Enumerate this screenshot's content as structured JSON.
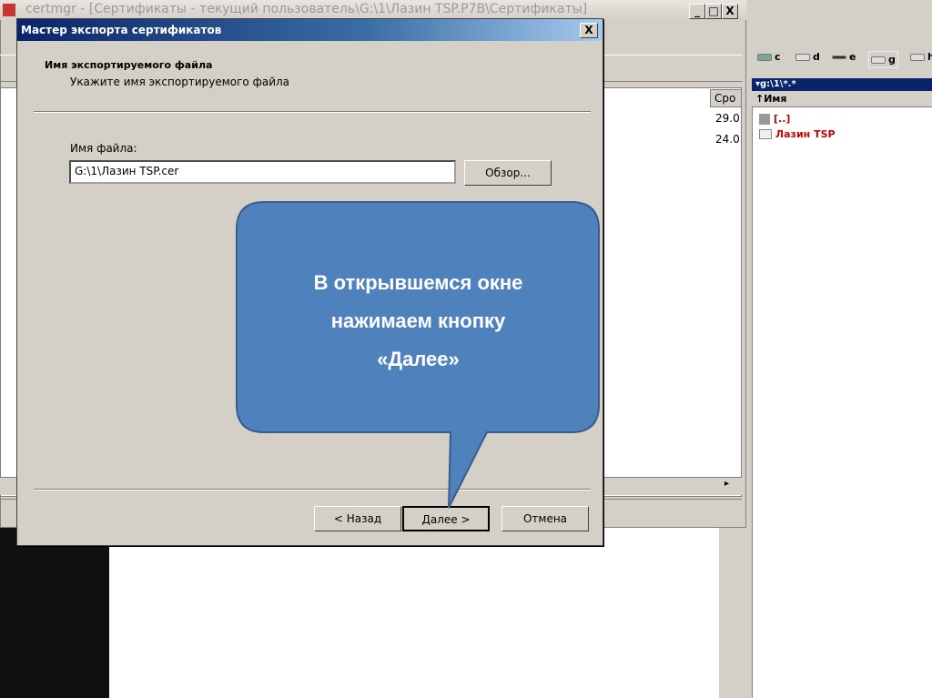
{
  "background_window": {
    "title": "certmgr - [Сертификаты - текущий пользователь\\G:\\1\\Лазин TSP.P7B\\Сертификаты]",
    "column_header": "Сро",
    "dates": [
      "29.0",
      "24.0"
    ],
    "buttons": {
      "minimize": "_",
      "maximize": "□",
      "close": "X"
    }
  },
  "total_commander": {
    "drives": [
      "c",
      "d",
      "e",
      "g",
      "h"
    ],
    "path": "▾g:\\1\\*.*",
    "column_name": "↑Имя",
    "files": [
      "[..]",
      "Лазин TSP"
    ]
  },
  "dialog": {
    "title": "Мастер экспорта сертификатов",
    "close": "X",
    "heading": "Имя экспортируемого файла",
    "subheading": "Укажите имя экспортируемого файла",
    "file_label": "Имя файла:",
    "file_value": "G:\\1\\Лазин TSP.cer",
    "browse": "Обзор...",
    "back": "< Назад",
    "next": "Далее >",
    "cancel": "Отмена"
  },
  "callout": {
    "lines": [
      "В открывшемся окне",
      "нажимаем кнопку",
      "«Далее»"
    ],
    "color": "#4f81bd"
  }
}
